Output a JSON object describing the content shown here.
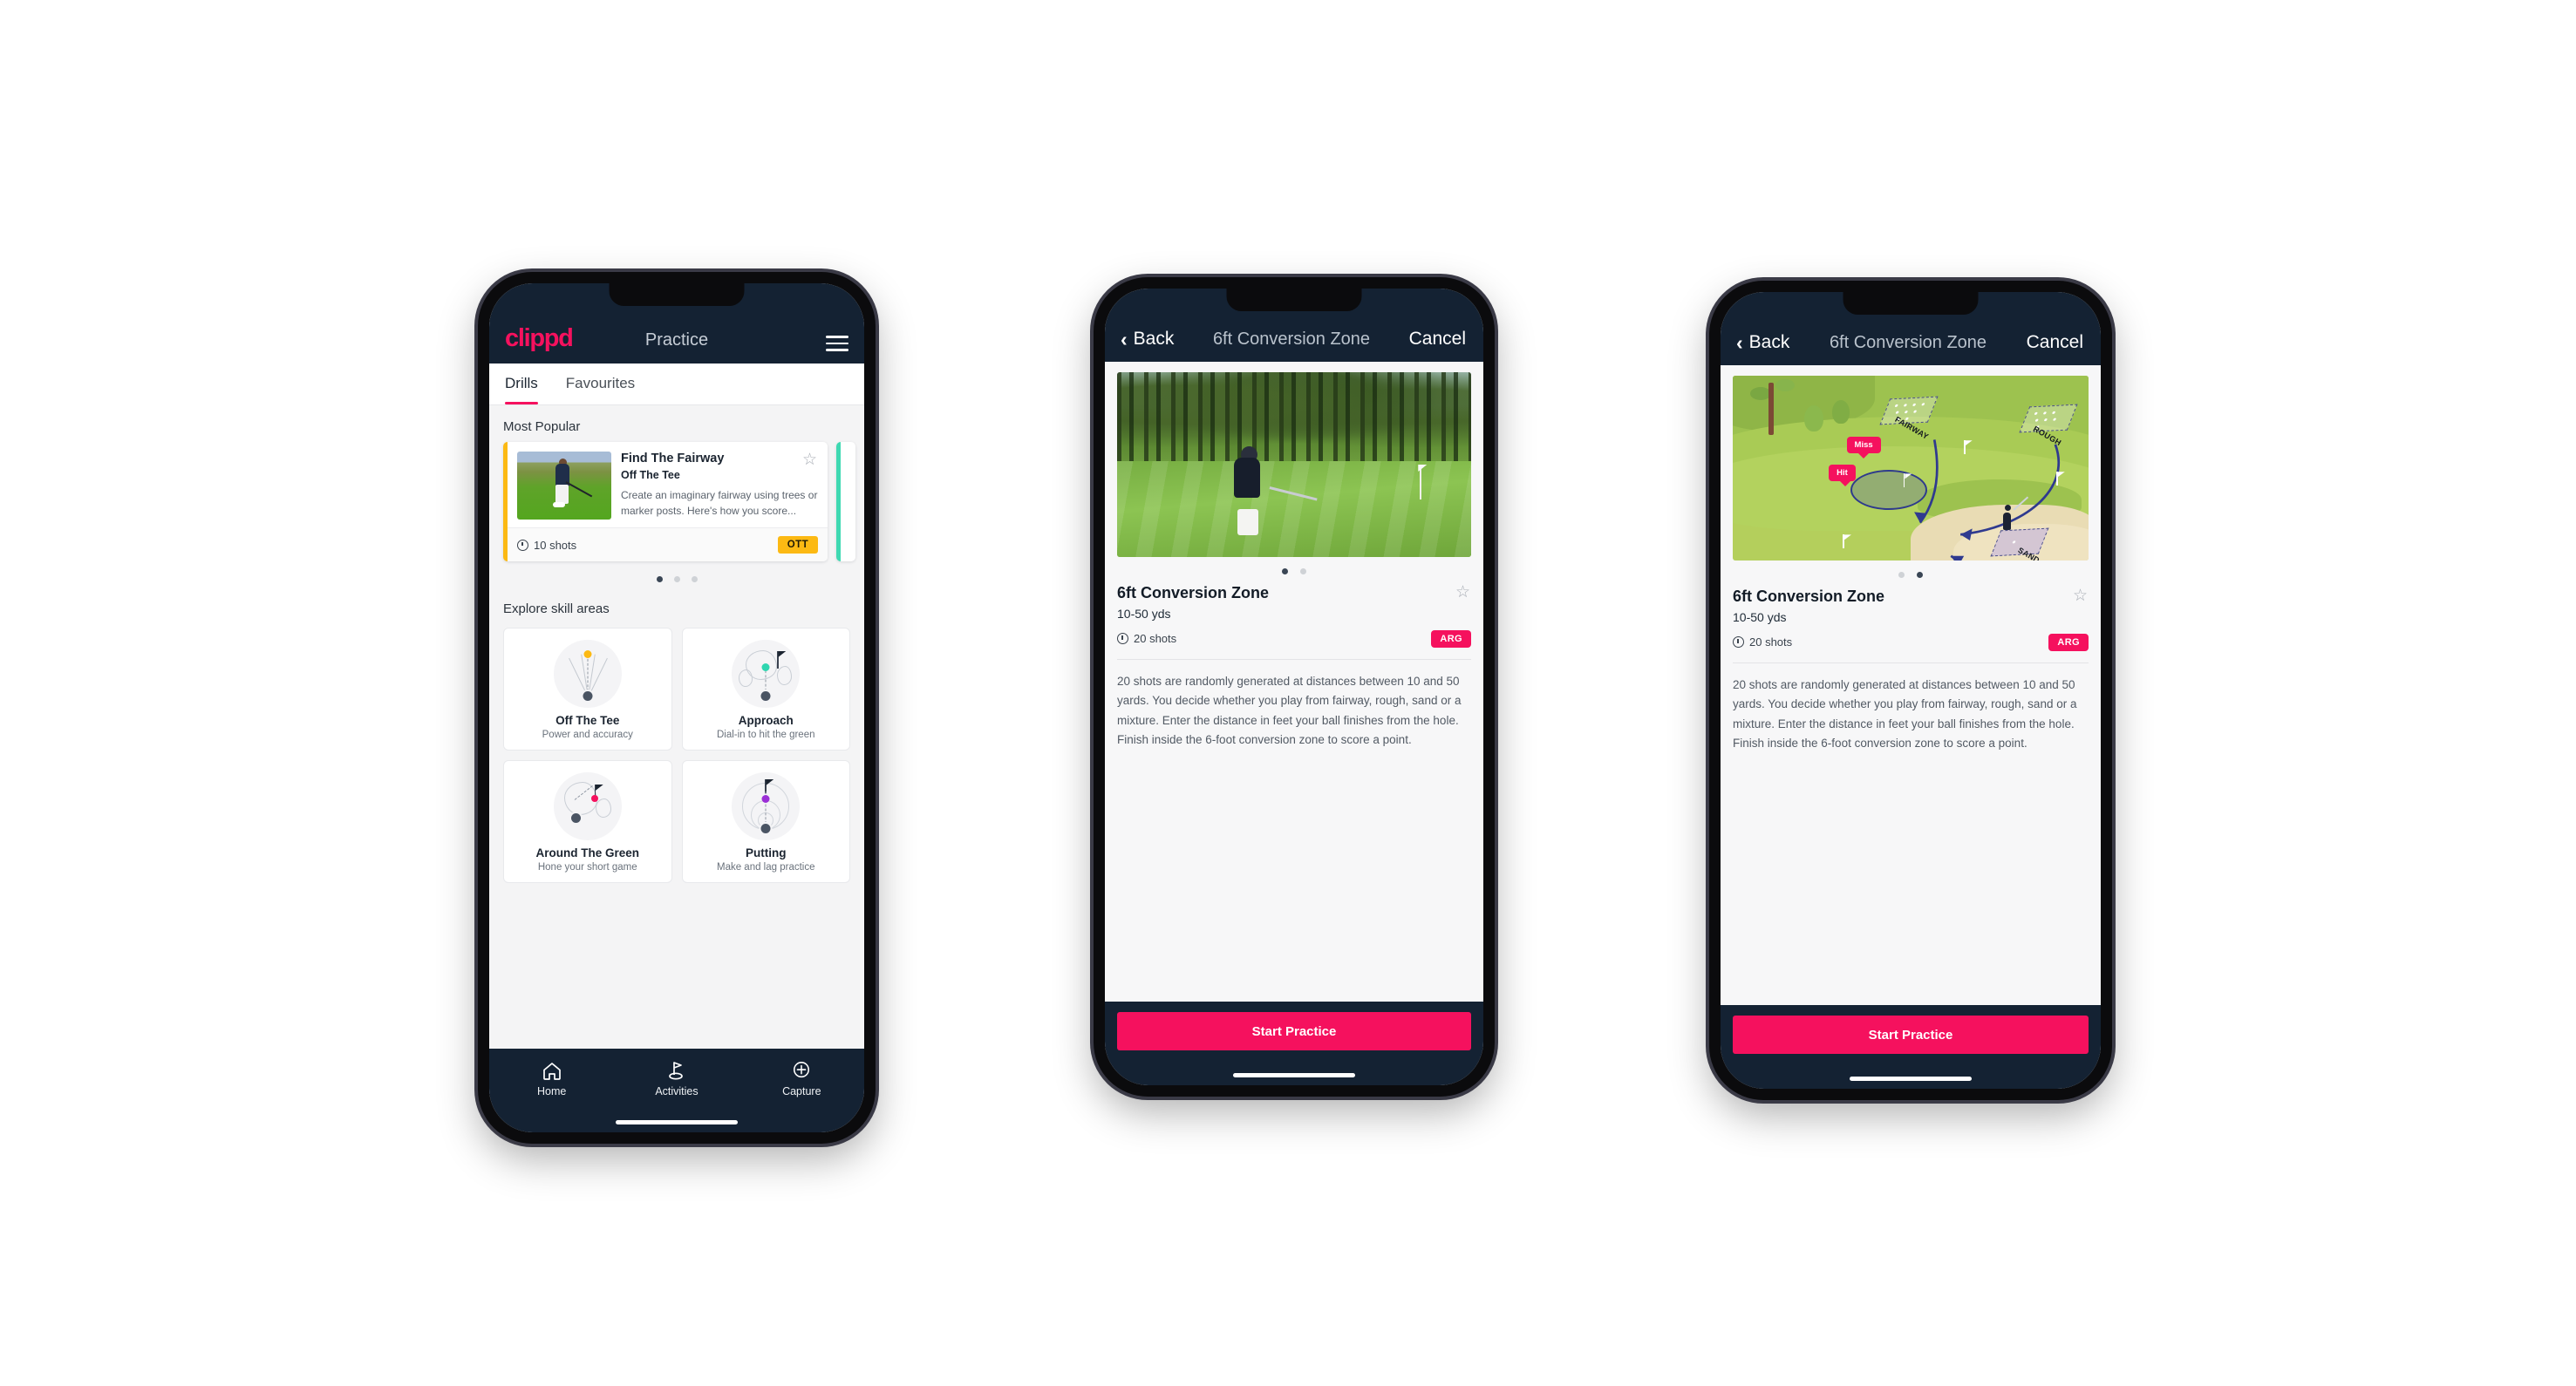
{
  "phone1": {
    "appbar": {
      "logo": "clippd",
      "title": "Practice",
      "menu_icon": "hamburger-icon"
    },
    "tabs": [
      {
        "label": "Drills",
        "active": true
      },
      {
        "label": "Favourites",
        "active": false
      }
    ],
    "most_popular": {
      "section_label": "Most Popular",
      "card": {
        "title": "Find The Fairway",
        "subtitle": "Off The Tee",
        "description": "Create an imaginary fairway using trees or marker posts. Here's how you score...",
        "shots": "10 shots",
        "badge": "OTT",
        "badge_color": "#fcb913",
        "accent_color": "#fcb913",
        "next_accent_color": "#3fd9b2",
        "favourite_icon": "star-outline-icon"
      },
      "dots": {
        "count": 3,
        "active": 0
      }
    },
    "explore": {
      "section_label": "Explore skill areas",
      "cards": [
        {
          "name": "Off The Tee",
          "desc": "Power and accuracy",
          "art": "tee-fan-icon",
          "dot_color": "#fcb913"
        },
        {
          "name": "Approach",
          "desc": "Dial-in to hit the green",
          "art": "approach-green-icon",
          "dot_color": "#2fd6b0"
        },
        {
          "name": "Around The Green",
          "desc": "Hone your short game",
          "art": "around-green-icon",
          "dot_color": "#f5115e"
        },
        {
          "name": "Putting",
          "desc": "Make and lag practice",
          "art": "putting-rings-icon",
          "dot_color": "#9b2fd6"
        }
      ]
    },
    "bottom_nav": [
      {
        "label": "Home",
        "icon": "home-icon",
        "active": false
      },
      {
        "label": "Activities",
        "icon": "golf-flag-icon",
        "active": true
      },
      {
        "label": "Capture",
        "icon": "plus-circle-icon",
        "active": false
      }
    ]
  },
  "phone2": {
    "nav": {
      "back": "Back",
      "title": "6ft Conversion Zone",
      "cancel": "Cancel",
      "back_icon": "chevron-left-icon"
    },
    "media": {
      "type": "photo",
      "alt": "golfer-chipping-photo"
    },
    "dots": {
      "count": 2,
      "active": 0
    },
    "detail": {
      "title": "6ft Conversion Zone",
      "yards": "10-50 yds",
      "shots": "20 shots",
      "badge": "ARG",
      "badge_color": "#f5115e",
      "favourite_icon": "star-outline-icon",
      "description": "20 shots are randomly generated at distances between 10 and 50 yards. You decide whether you play from fairway, rough, sand or a mixture. Enter the distance in feet your ball finishes from the hole. Finish inside the 6-foot conversion zone to score a point."
    },
    "cta": {
      "label": "Start Practice",
      "color": "#f5115e"
    }
  },
  "phone3": {
    "nav": {
      "back": "Back",
      "title": "6ft Conversion Zone",
      "cancel": "Cancel",
      "back_icon": "chevron-left-icon"
    },
    "media": {
      "type": "illustration",
      "alt": "golf-course-diagram",
      "zone_labels": [
        "FAIRWAY",
        "ROUGH",
        "SAND"
      ],
      "pins": [
        {
          "label": "Miss",
          "color": "#f5115e"
        },
        {
          "label": "Hit",
          "color": "#f5115e"
        }
      ]
    },
    "dots": {
      "count": 2,
      "active": 1
    },
    "detail": {
      "title": "6ft Conversion Zone",
      "yards": "10-50 yds",
      "shots": "20 shots",
      "badge": "ARG",
      "badge_color": "#f5115e",
      "favourite_icon": "star-outline-icon",
      "description": "20 shots are randomly generated at distances between 10 and 50 yards. You decide whether you play from fairway, rough, sand or a mixture. Enter the distance in feet your ball finishes from the hole. Finish inside the 6-foot conversion zone to score a point."
    },
    "cta": {
      "label": "Start Practice",
      "color": "#f5115e"
    }
  }
}
